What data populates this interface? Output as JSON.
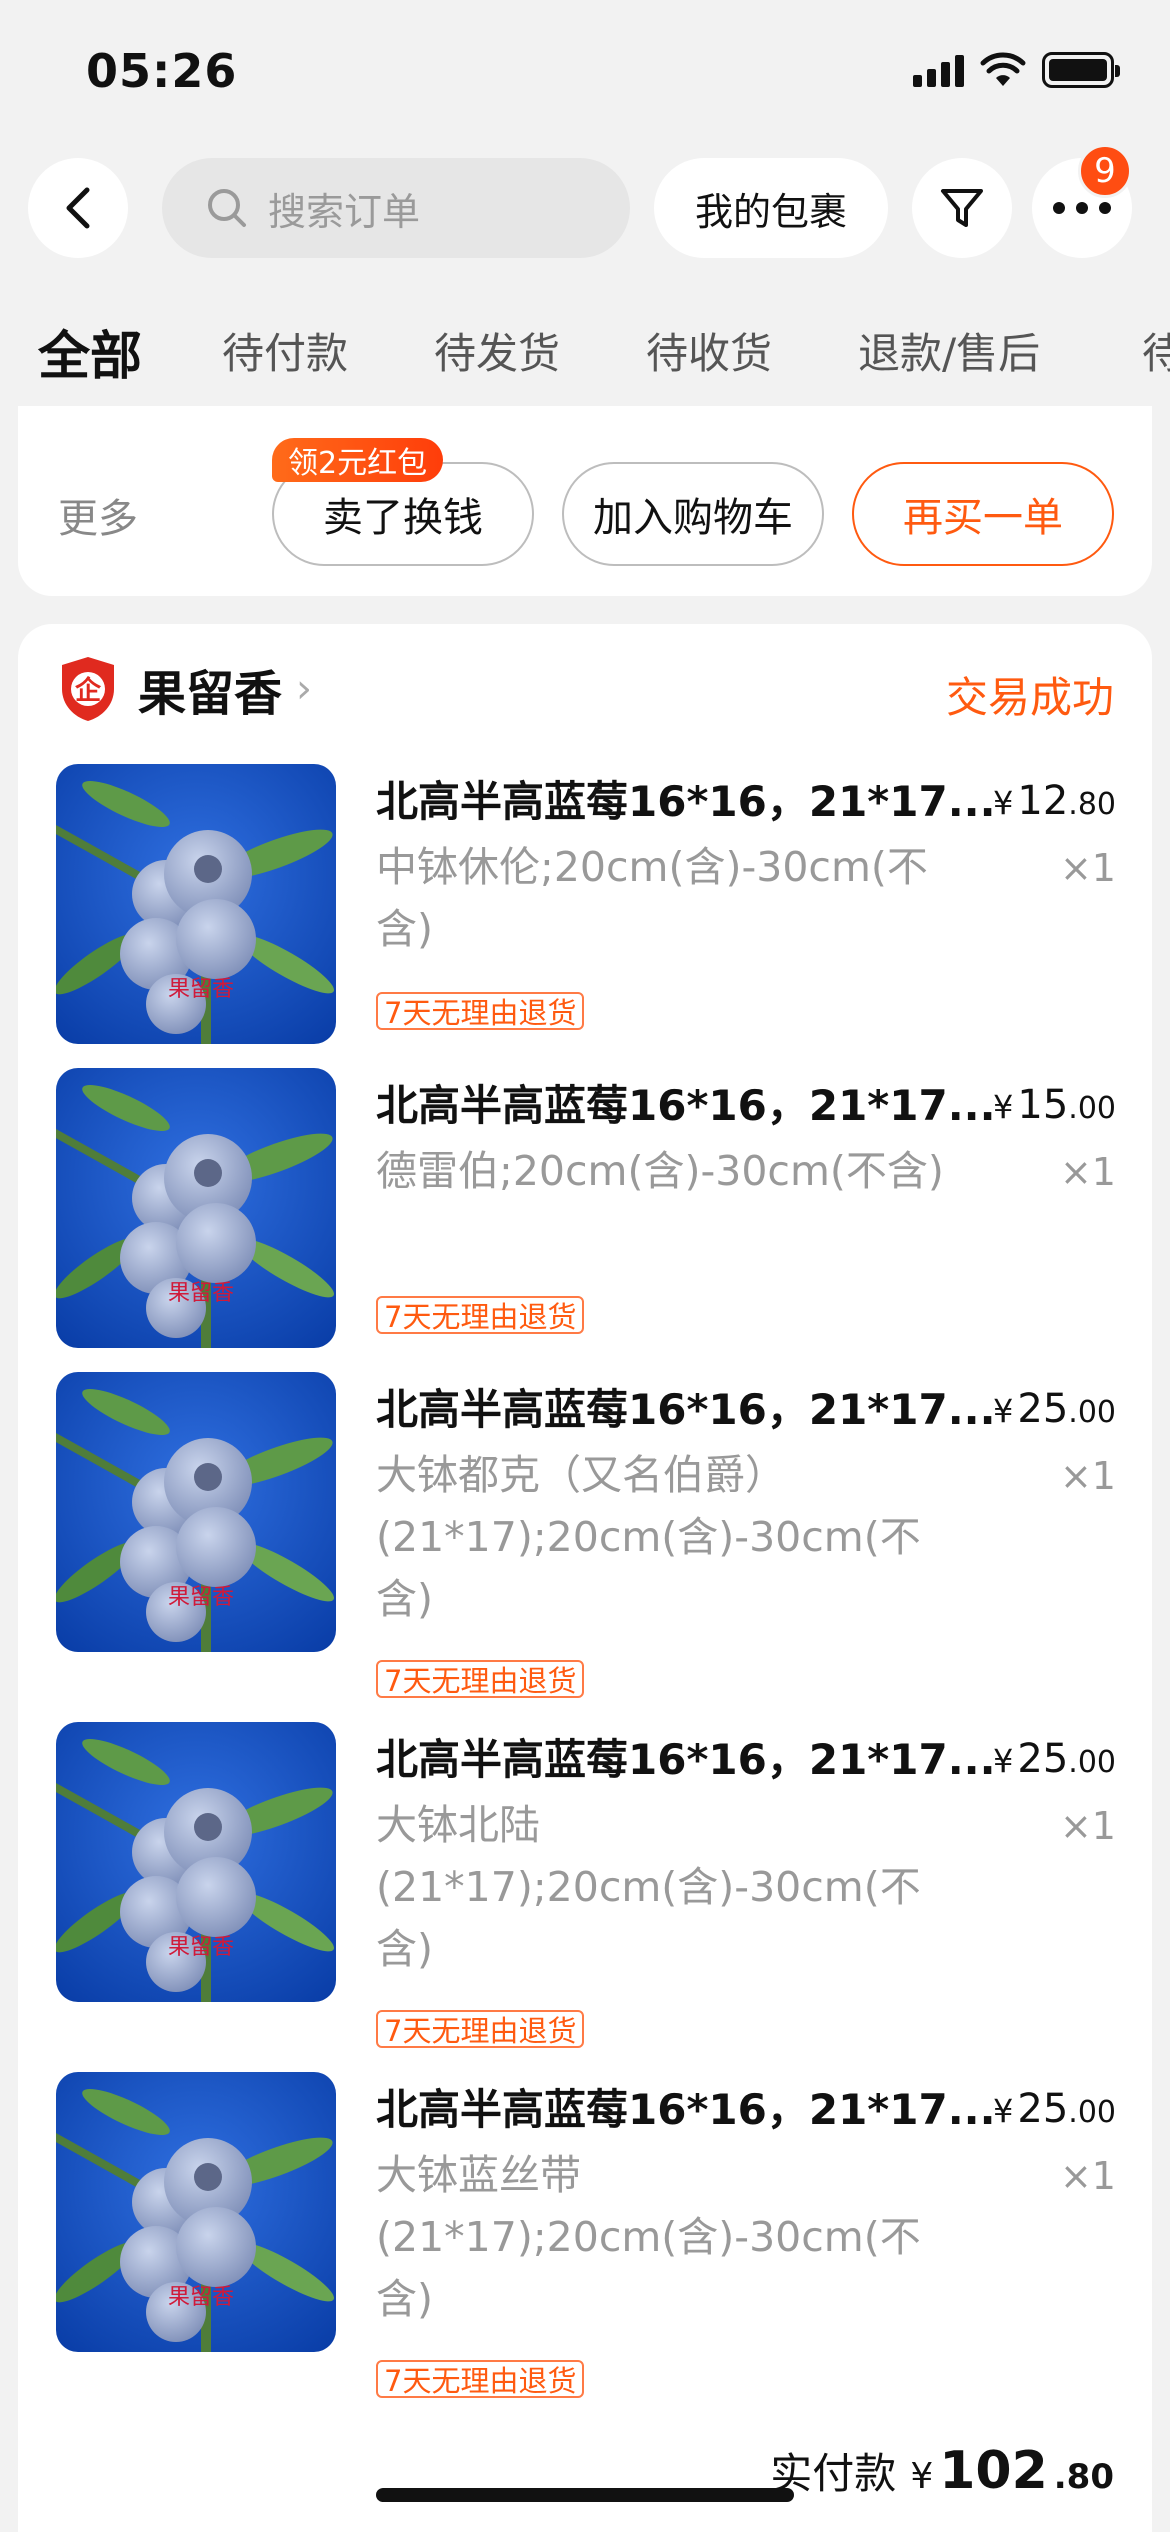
{
  "status_bar": {
    "time": "05:26"
  },
  "nav": {
    "search_placeholder": "搜索订单",
    "my_package_label": "我的包裹",
    "more_badge": "9"
  },
  "tabs": [
    "全部",
    "待付款",
    "待发货",
    "待收货",
    "退款/售后",
    "待"
  ],
  "prev_order_actions": {
    "more_label": "更多",
    "redpack_tag": "领2元红包",
    "sell_label": "卖了换钱",
    "add_cart_label": "加入购物车",
    "rebuy_label": "再买一单"
  },
  "order": {
    "shop_name": "果留香",
    "status": "交易成功",
    "items": [
      {
        "title": "北高半高蓝莓16*16，21*17...",
        "spec": "中钵休伦;20cm(含)-30cm(不含)",
        "price_int": "12",
        "price_dec": ".80",
        "qty": "×1",
        "tag": "7天无理由退货"
      },
      {
        "title": "北高半高蓝莓16*16，21*17...",
        "spec": "德雷伯;20cm(含)-30cm(不含)",
        "price_int": "15",
        "price_dec": ".00",
        "qty": "×1",
        "tag": "7天无理由退货"
      },
      {
        "title": "北高半高蓝莓16*16，21*17...",
        "spec": "大钵都克（又名伯爵）(21*17);20cm(含)-30cm(不含)",
        "price_int": "25",
        "price_dec": ".00",
        "qty": "×1",
        "tag": "7天无理由退货"
      },
      {
        "title": "北高半高蓝莓16*16，21*17...",
        "spec": "大钵北陆(21*17);20cm(含)-30cm(不含)",
        "price_int": "25",
        "price_dec": ".00",
        "qty": "×1",
        "tag": "7天无理由退货"
      },
      {
        "title": "北高半高蓝莓16*16，21*17...",
        "spec": "大钵蓝丝带(21*17);20cm(含)-30cm(不含)",
        "price_int": "25",
        "price_dec": ".00",
        "qty": "×1",
        "tag": "7天无理由退货"
      }
    ],
    "total_label": "实付款",
    "total_currency": "¥",
    "total_int": "102",
    "total_dec": ".80",
    "currency": "¥"
  },
  "colors": {
    "accent": "#ff5a10",
    "badge": "#ff4d12"
  }
}
